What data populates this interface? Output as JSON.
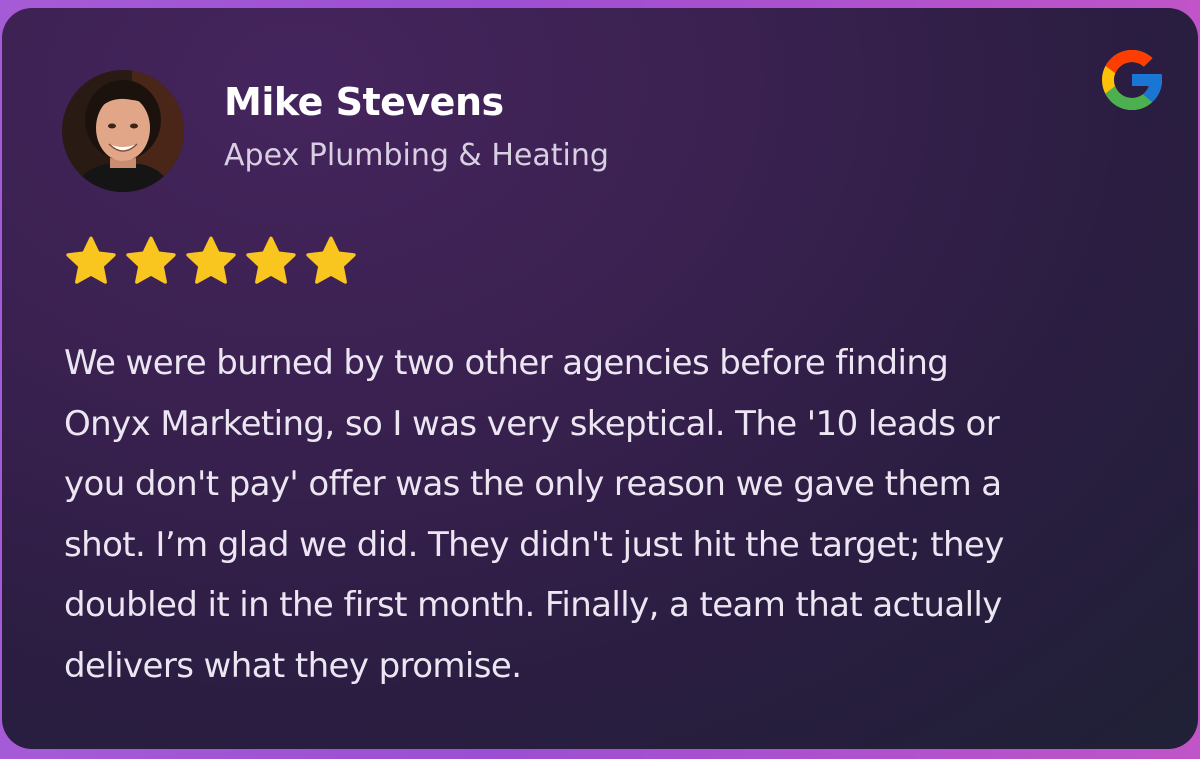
{
  "reviewer": {
    "name": "Mike Stevens",
    "company": "Apex Plumbing & Heating",
    "avatar": "reviewer-photo"
  },
  "source_icon": "google-g-icon",
  "rating": {
    "value": 5,
    "max": 5,
    "star_color": "#f9c51f"
  },
  "review": {
    "lines": [
      "We were burned by two other agencies before finding",
      "Onyx Marketing, so I was very skeptical. The '10 leads or",
      "you don't pay' offer was the only reason we gave them a",
      "shot. I’m glad we did. They didn't just hit the target; they",
      "doubled it in the first month. Finally, a team that actually",
      "delivers what they promise."
    ]
  },
  "colors": {
    "card_bg_top": "#45245d",
    "card_bg_bottom": "#1f2035",
    "border_gradient_start": "#a65bd6",
    "border_gradient_end": "#c054c8"
  }
}
